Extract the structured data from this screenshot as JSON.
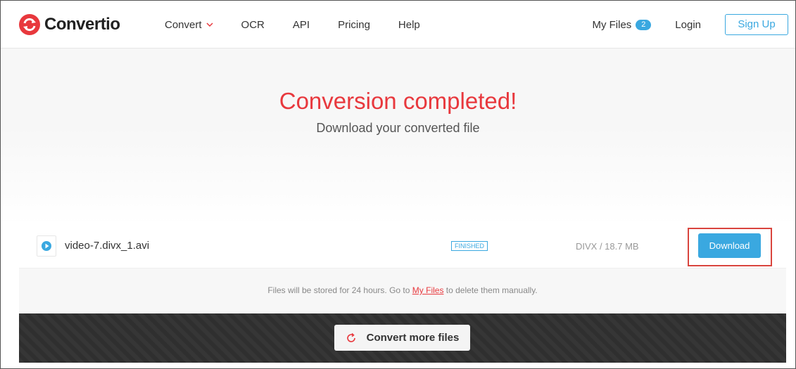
{
  "header": {
    "logo_text": "Convertio",
    "nav": [
      "Convert",
      "OCR",
      "API",
      "Pricing",
      "Help"
    ],
    "my_files_label": "My Files",
    "my_files_count": "2",
    "login_label": "Login",
    "signup_label": "Sign Up"
  },
  "hero": {
    "title": "Conversion completed!",
    "subtitle": "Download your converted file"
  },
  "file": {
    "name": "video-7.divx_1.avi",
    "status": "FINISHED",
    "meta": "DIVX / 18.7 MB",
    "download_label": "Download",
    "icon": "play-icon"
  },
  "info": {
    "prefix": "Files will be stored for 24 hours. Go to ",
    "link": "My Files",
    "suffix": " to delete them manually."
  },
  "convert_more_label": "Convert more files",
  "colors": {
    "accent": "#3aa8e0",
    "brand_red": "#e8383d",
    "highlight": "#d9453e"
  }
}
